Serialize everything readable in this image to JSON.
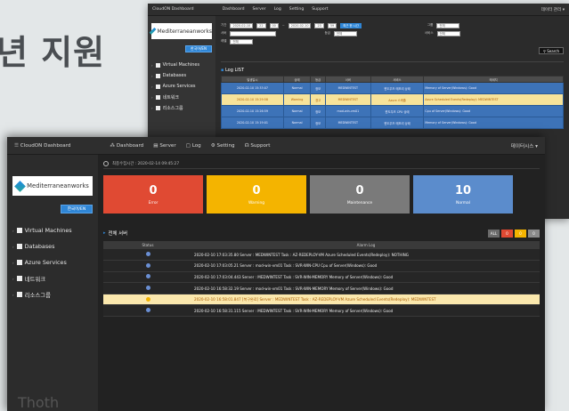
{
  "bg_title": "년 지원",
  "app": {
    "brand": "CloudON Dashboard",
    "nav": [
      "Dashboard",
      "Server",
      "Log",
      "Setting",
      "Support"
    ],
    "user": "데이터시스 ▾"
  },
  "sidebar": {
    "logo": "Mediterraneanworks",
    "lang_button": "한국어/EN",
    "items": [
      "Virtual Machines",
      "Databases",
      "Azure Services",
      "네트워크",
      "리소스그룹"
    ]
  },
  "back": {
    "user": "데이터 관리 ▾",
    "filters": {
      "row1": {
        "label": "기간",
        "start": "2020-02-10",
        "h1": "22",
        "m1": "00",
        "sep": "~",
        "end": "2020-02-10",
        "h2": "23",
        "m2": "59",
        "btn": "최근 한 시간",
        "col_label": "그룹",
        "col_value": "전체"
      },
      "row2": {
        "label": "서버",
        "status_label": "등급",
        "status_value": "전체",
        "svc_label": "서비스",
        "svc_value": "전체"
      },
      "row3": {
        "label": "레벨",
        "value": "전체"
      },
      "search": "Search"
    },
    "log_title": "Log LIST",
    "columns": [
      "발생일시",
      "상태",
      "등급",
      "서버",
      "서비스",
      "메세지"
    ],
    "rows": [
      {
        "date": "2020-02-10 15:33:07",
        "status": "Normal",
        "level": "정보",
        "server": "MEDWINTEST",
        "service": "윈도우즈 메모리 상태",
        "msg": "Memory of Server(Windows): Good",
        "warn": false
      },
      {
        "date": "2020-02-10 15:29:58",
        "status": "Warning",
        "level": "경고",
        "server": "MEDWINTEST",
        "service": "Azure 스케줄",
        "msg": "Azure Scheduled Events(Redeploy): MEDWINTEST",
        "warn": true
      },
      {
        "date": "2020-02-10 15:26:59",
        "status": "Normal",
        "level": "정보",
        "server": "mod-win-vm01",
        "service": "윈도우즈 CPU 상태",
        "msg": "Cpu of Server(Windows): Good",
        "warn": false
      },
      {
        "date": "2020-02-10 15:19:01",
        "status": "Normal",
        "level": "정보",
        "server": "MEDWINTEST",
        "service": "윈도우즈 메모리 상태",
        "msg": "Memory of Server(Windows): Good",
        "warn": false
      }
    ]
  },
  "front": {
    "update_time": "최종수집시간 : 2020-02-14 09:45:27",
    "cards": [
      {
        "value": "0",
        "label": "Error",
        "color": "#e04a33"
      },
      {
        "value": "0",
        "label": "Warning",
        "color": "#f4b400"
      },
      {
        "value": "0",
        "label": "Maintenance",
        "color": "#7a7a7a"
      },
      {
        "value": "10",
        "label": "Normal",
        "color": "#5b8ccc"
      }
    ],
    "section_title": "전체 서버",
    "filter_badges": [
      {
        "label": "ALL",
        "color": "#6b6b6b"
      },
      {
        "label": "0",
        "color": "#e04a33"
      },
      {
        "label": "0",
        "color": "#f4b400"
      },
      {
        "label": "0",
        "color": "#8a8a8a"
      }
    ],
    "table_headers": [
      "Status",
      "Alarm Log"
    ],
    "alarms": [
      {
        "msg": "2020-02-10 17:03:35.80 Server : MEDWINTEST Task : AZ-REDEPLOY-VM Azure Scheduled Events(Redeploy): NOTHING",
        "warn": false
      },
      {
        "msg": "2020-02-10 17:03:05.21 Server : mod-win-vm01 Task : SVR-WIN-CPU Cpu of Server(Windows): Good",
        "warn": false
      },
      {
        "msg": "2020-02-10 17:03:04.443 Server : MEDWINTEST Task : SVR-WIN-MEMORY Memory of Server(Windows): Good",
        "warn": false
      },
      {
        "msg": "2020-02-10 16:58:32.19 Server : mod-win-vm01 Task : SVR-WIN-MEMORY Memory of Server(Windows): Good",
        "warn": false
      },
      {
        "msg": "2020-02-10 16:58:01.847 [복구완료] Server : MEDWINTEST Task : AZ-REDEPLOY-VM Azure Scheduled Events(Redeploy): MEDWINTEST",
        "warn": true
      },
      {
        "msg": "2020-02-10 16:58:31.115 Server : MEDWINTEST Task : SVR-WIN-MEMORY Memory of Server(Windows): Good",
        "warn": false
      }
    ],
    "footer_logo": "Thoth"
  }
}
